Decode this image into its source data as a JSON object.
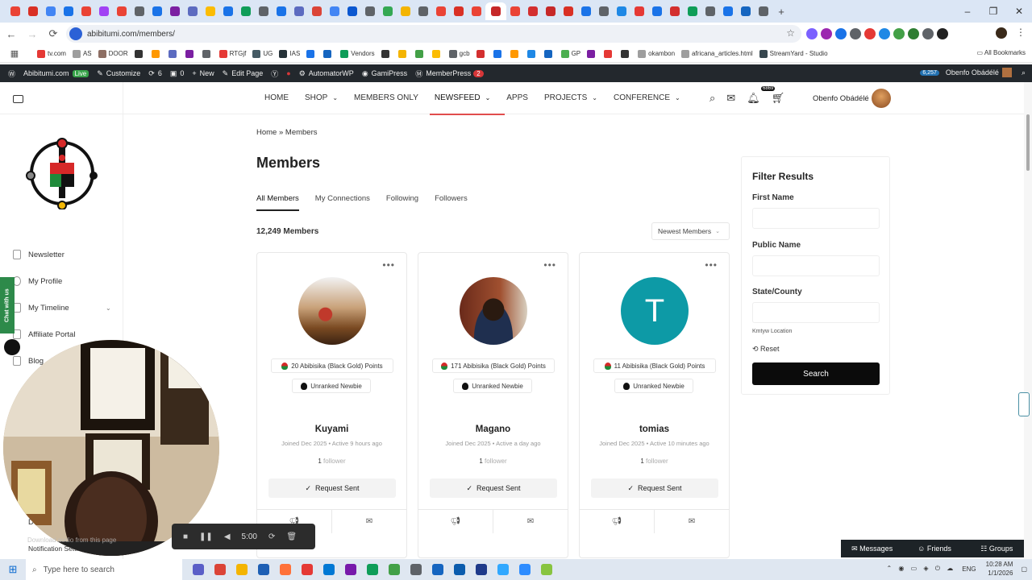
{
  "browser": {
    "tab_colors": [
      "#ea4335",
      "#d93025",
      "#4285f4",
      "#1a73e8",
      "#ea4335",
      "#a142f4",
      "#ea4335",
      "#5f6368",
      "#1a73e8",
      "#7b1fa2",
      "#5c6bc0",
      "#fbbc04",
      "#1a73e8",
      "#0f9d58",
      "#5f6368",
      "#1a73e8",
      "#5c6bc0",
      "#db4437",
      "#4285f4",
      "#0b57d0",
      "#5f6368",
      "#34a853",
      "#f4b400",
      "#5f6368",
      "#ea4335",
      "#d93025",
      "#ea4335",
      "#c62828",
      "#ea4335",
      "#d32f2f",
      "#c62828",
      "#d93025",
      "#1a73e8",
      "#5f6368",
      "#1e88e5",
      "#e53935",
      "#1a73e8",
      "#d32f2f",
      "#0f9d58",
      "#5f6368",
      "#1a73e8",
      "#1565c0",
      "#5f6368"
    ],
    "url": "abibitumi.com/members/",
    "window_controls": [
      "–",
      "❐",
      "✕"
    ],
    "extension_colors": [
      "#7b61ff",
      "#9c27b0",
      "#1a73e8",
      "#5f6368",
      "#e53935",
      "#1e88e5",
      "#43a047",
      "#2e7d32",
      "#5f6368",
      "#212121"
    ]
  },
  "bookmarks": [
    {
      "label": "tv.com",
      "color": "#e53935"
    },
    {
      "label": "AS",
      "color": "#9e9e9e"
    },
    {
      "label": "DOOR",
      "color": "#8d6e63"
    },
    {
      "label": "",
      "color": "#333"
    },
    {
      "label": "",
      "color": "#ff9800"
    },
    {
      "label": "",
      "color": "#5c6bc0"
    },
    {
      "label": "",
      "color": "#7b1fa2"
    },
    {
      "label": "",
      "color": "#5f6368"
    },
    {
      "label": "RTGjf",
      "color": "#e53935"
    },
    {
      "label": "UG",
      "color": "#455a64"
    },
    {
      "label": "IAS",
      "color": "#263238"
    },
    {
      "label": "",
      "color": "#1a73e8"
    },
    {
      "label": "",
      "color": "#1565c0"
    },
    {
      "label": "Vendors",
      "color": "#0f9d58"
    },
    {
      "label": "",
      "color": "#333"
    },
    {
      "label": "",
      "color": "#f4b400"
    },
    {
      "label": "",
      "color": "#43a047"
    },
    {
      "label": "",
      "color": "#fbbc04"
    },
    {
      "label": "gcb",
      "color": "#5f6368"
    },
    {
      "label": "",
      "color": "#d32f2f"
    },
    {
      "label": "",
      "color": "#1a73e8"
    },
    {
      "label": "",
      "color": "#ff9800"
    },
    {
      "label": "",
      "color": "#1e88e5"
    },
    {
      "label": "",
      "color": "#1565c0"
    },
    {
      "label": "GP",
      "color": "#4caf50"
    },
    {
      "label": "",
      "color": "#7b1fa2"
    },
    {
      "label": "",
      "color": "#e53935"
    },
    {
      "label": "",
      "color": "#333"
    },
    {
      "label": "okambon",
      "color": "#9e9e9e"
    },
    {
      "label": "africana_articles.html",
      "color": "#9e9e9e"
    },
    {
      "label": "StreamYard - Studio",
      "color": "#37474f"
    }
  ],
  "bookmarks_all": "All Bookmarks",
  "wpbar": {
    "site": "Abibitumi.com",
    "live": "Live",
    "customize": "Customize",
    "updates": "6",
    "comments": "0",
    "new": "New",
    "edit": "Edit Page",
    "automator": "AutomatorWP",
    "gamipress": "GamiPress",
    "memberpress": "MemberPress",
    "memberpress_badge": "2",
    "count": "6,257",
    "user": "Obenfo Obádélé"
  },
  "nav": {
    "items": [
      "HOME",
      "SHOP",
      "MEMBERS ONLY",
      "NEWSFEED",
      "APPS",
      "PROJECTS",
      "CONFERENCE"
    ],
    "notif_count": "6869",
    "user": "Obenfo Obádélé"
  },
  "sidebar": {
    "items": [
      "Newsletter",
      "My Profile",
      "My Timeline",
      "Affiliate Portal",
      "Blog",
      "De",
      "Notification Settings"
    ],
    "chat_tab": "Chat with us"
  },
  "main": {
    "breadcrumb": "Home » Members",
    "title": "Members",
    "tabs": [
      "All Members",
      "My Connections",
      "Following",
      "Followers"
    ],
    "count": "12,249 Members",
    "sort": "Newest Members"
  },
  "members": [
    {
      "name": "Kuyami",
      "points": "20 Abibisika (Black Gold) Points",
      "rank": "Unranked Newbie",
      "joined": "Joined Dec 2025",
      "active": "Active 9 hours ago",
      "followers": "1",
      "followers_label": "follower",
      "request": "Request Sent",
      "avatar": "photo-red"
    },
    {
      "name": "Magano",
      "points": "171 Abibisika (Black Gold) Points",
      "rank": "Unranked Newbie",
      "joined": "Joined Dec 2025",
      "active": "Active a day ago",
      "followers": "1",
      "followers_label": "follower",
      "request": "Request Sent",
      "avatar": "photo-man"
    },
    {
      "name": "tomias",
      "points": "11 Abibisika (Black Gold) Points",
      "rank": "Unranked Newbie",
      "joined": "Joined Dec 2025",
      "active": "Active 10 minutes ago",
      "followers": "1",
      "followers_label": "follower",
      "request": "Request Sent",
      "avatar": "T"
    }
  ],
  "filter": {
    "title": "Filter Results",
    "first_name": "First Name",
    "public_name": "Public Name",
    "state": "State/County",
    "location": "Kmtyw Location",
    "reset": "Reset",
    "search": "Search"
  },
  "recorder": {
    "time": "5:00",
    "hint": "Download audio from this page"
  },
  "chatbar": {
    "messages": "Messages",
    "friends": "Friends",
    "groups": "Groups"
  },
  "taskbar": {
    "search": "Type here to search",
    "lang": "ENG",
    "time": "10:28 AM",
    "date": "1/1/2026"
  }
}
